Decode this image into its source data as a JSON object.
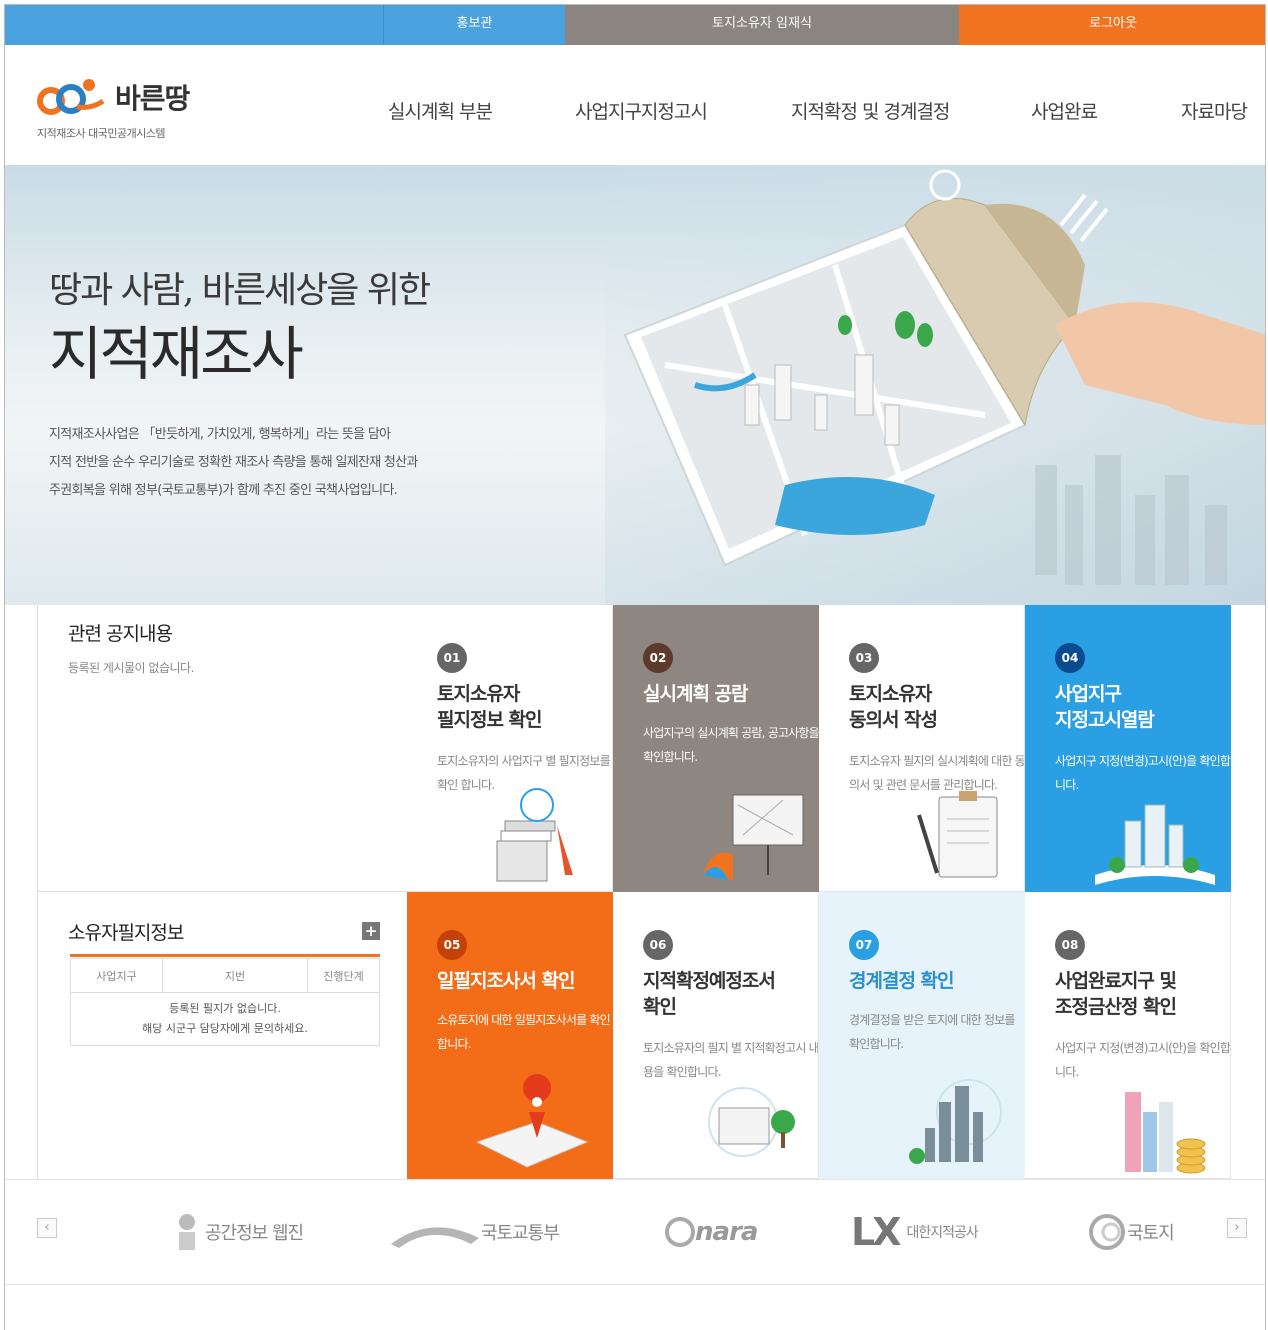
{
  "topbar": {
    "items": [
      {
        "label": "홍보관"
      },
      {
        "label": "토지소유자 임재식"
      },
      {
        "label": "로그아웃"
      }
    ]
  },
  "header": {
    "logo_name": "바른땅",
    "logo_sub": "지적재조사 대국민공개시스템",
    "nav": [
      {
        "label": "실시계획 부분"
      },
      {
        "label": "사업지구지정고시"
      },
      {
        "label": "지적확정 및 경계결정"
      },
      {
        "label": "사업완료"
      },
      {
        "label": "자료마당"
      }
    ]
  },
  "hero": {
    "title1": "땅과 사람, 바른세상을 위한",
    "title2": "지적재조사",
    "desc": [
      "지적재조사사업은 「반듯하게, 가치있게, 행복하게」라는 뜻을 담아",
      "지적 전반을 순수 우리기술로 정확한 재조사 측량을 통해 일제잔재 청산과",
      "주권회복을 위해 정부(국토교통부)가 함께 추진 중인 국책사업입니다."
    ]
  },
  "notice": {
    "title": "관련 공지내용",
    "empty": "등록된 게시물이 없습니다."
  },
  "owner": {
    "title": "소유자필지정보",
    "plus": "+",
    "columns": [
      "사업지구",
      "지번",
      "진행단계"
    ],
    "empty1": "등록된 필지가 없습니다.",
    "empty2": "해당 시군구 담당자에게 문의하세요."
  },
  "tiles": [
    {
      "num": "01",
      "title": "토지소유자\n필지정보 확인",
      "desc": "토지소유자의 사업지구 별 필지정보를 확인 합니다."
    },
    {
      "num": "02",
      "title": "실시계획 공람",
      "desc": "사업지구의 실시계획 공람, 공고사항을 확인합니다."
    },
    {
      "num": "03",
      "title": "토지소유자\n동의서 작성",
      "desc": "토지소유자 필지의 실시계획에 대한 동의서 및 관련 문서를 관리합니다."
    },
    {
      "num": "04",
      "title": "사업지구\n지정고시열람",
      "desc": "사업지구 지정(변경)고시(안)을 확인합니다."
    },
    {
      "num": "05",
      "title": "일필지조사서 확인",
      "desc": "소유토지에 대한 일필지조사서를 확인합니다."
    },
    {
      "num": "06",
      "title": "지적확정예정조서\n확인",
      "desc": "토지소유자의 필지 별 지적확정고시 내용을 확인합니다."
    },
    {
      "num": "07",
      "title": "경계결정 확인",
      "desc": "경계결정을 받은 토지에 대한 정보를 확인합니다."
    },
    {
      "num": "08",
      "title": "사업완료지구 및\n조정금산정 확인",
      "desc": "사업지구 지정(변경)고시(안)을 확인합니다."
    }
  ],
  "partners": {
    "prev": "‹",
    "next": "›",
    "items": [
      {
        "label": "공간정보 웹진"
      },
      {
        "label": "국토교통부"
      },
      {
        "label": "nara"
      },
      {
        "label": "대한지적공사"
      },
      {
        "label": "국토지"
      }
    ]
  },
  "colors": {
    "blue": "#2b9fe3",
    "orange": "#f36c17",
    "gray": "#8e8680"
  }
}
